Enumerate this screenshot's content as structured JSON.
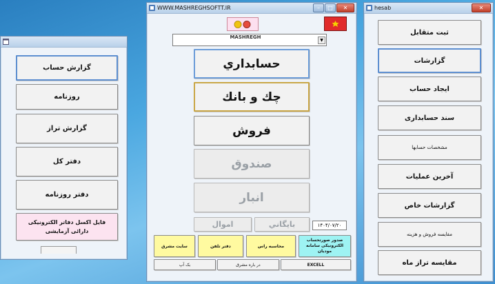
{
  "left_window": {
    "buttons": [
      "گزارش حساب",
      "روزنامه",
      "گزارش تراز",
      "دفتر کل",
      "دفتر روزنامه"
    ],
    "pink_button": "فایل اکسل دفاتر   الکترونیکی دارائی آزمایشی"
  },
  "main_window": {
    "title": "WWW.MASHREGHSOFTT.IR",
    "dropdown_value": "MASHREGH",
    "buttons": {
      "accounting": "حسابداري",
      "check_bank": "چك و بانك",
      "sales": "فروش",
      "cashbox": "صندوق",
      "warehouse": "انبار",
      "archive": "بايگاني",
      "assets": "اموال"
    },
    "date": "۱۴۰۴/۰۷/۲۰",
    "yellow_buttons": [
      "سایت مشرق",
      "دفتر تلفن",
      "محاسبه راس"
    ],
    "cyan_button": "صدور صورتحساب الکترونیکی سامانه مودیان",
    "bottom_buttons": {
      "backup": "بک آپ",
      "about": "در باره مشرق",
      "excel": "EXCELL"
    }
  },
  "right_window": {
    "title": "hesab",
    "buttons": [
      "ثبت متقابل",
      "گزارشات",
      "ایجاد حساب",
      "سند حسابداری",
      "مشخصات حسابها",
      "آخرین عملیات",
      "گزارشات خاص",
      "مقایسه فروش و هزینه",
      "مقایسه تراز ماه"
    ]
  },
  "colors": {
    "yellow": "#fffaa0",
    "cyan": "#9ef3f3",
    "pink": "#fce3f0",
    "flag": "#e12b2b",
    "selected_border": "#5c8ed0"
  }
}
